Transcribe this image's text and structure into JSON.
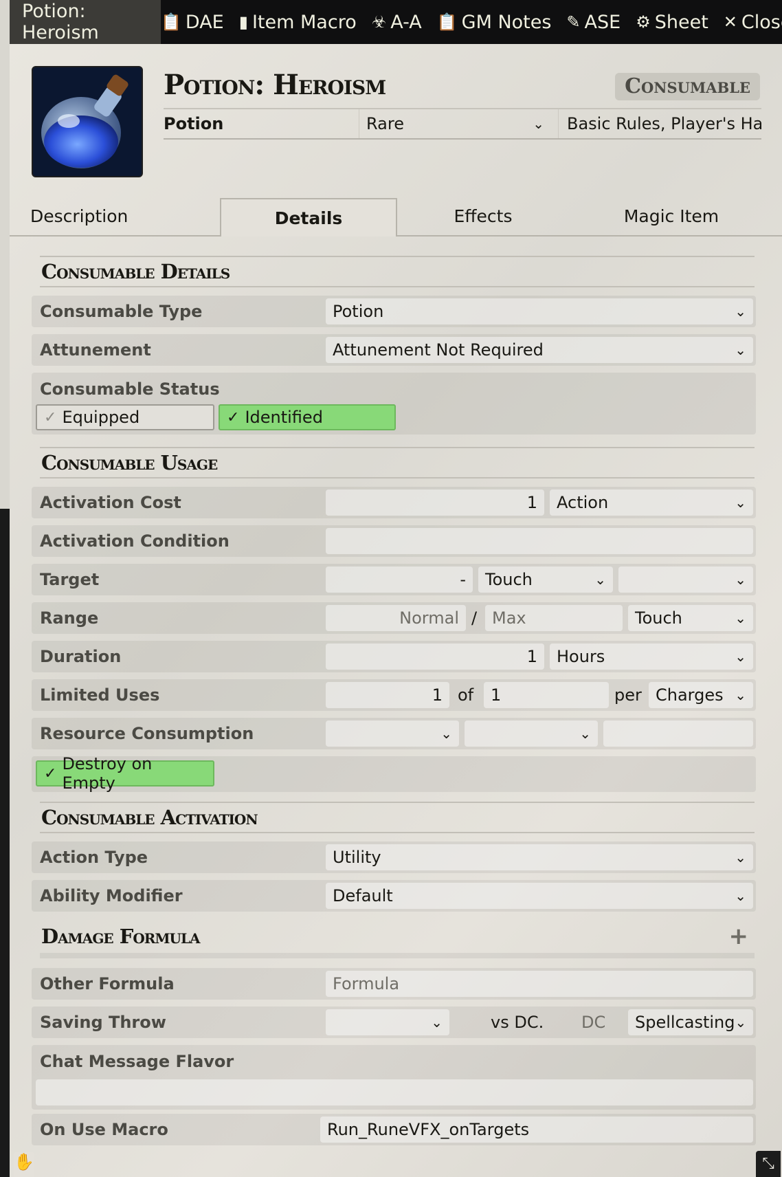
{
  "window": {
    "title": "Potion: Heroism",
    "controls": [
      {
        "label": "DAE",
        "icon": "clipboard-icon"
      },
      {
        "label": "Item Macro",
        "icon": "sd-card-icon"
      },
      {
        "label": "A-A",
        "icon": "biohazard-icon"
      },
      {
        "label": "GM Notes",
        "icon": "clipboard-icon"
      },
      {
        "label": "ASE",
        "icon": "magic-wand-icon"
      },
      {
        "label": "Sheet",
        "icon": "gear-icon"
      },
      {
        "label": "Close",
        "icon": "close-icon"
      }
    ]
  },
  "header": {
    "name": "Potion: Heroism",
    "type_badge": "Consumable",
    "subtype": "Potion",
    "rarity": "Rare",
    "source": "Basic Rules, Player's Ha"
  },
  "tabs": [
    "Description",
    "Details",
    "Effects",
    "Magic Item"
  ],
  "active_tab": "Details",
  "sections": {
    "details_title": "Consumable Details",
    "usage_title": "Consumable Usage",
    "activation_title": "Consumable Activation",
    "damage_title": "Damage Formula"
  },
  "details": {
    "consumable_type_label": "Consumable Type",
    "consumable_type": "Potion",
    "attunement_label": "Attunement",
    "attunement": "Attunement Not Required",
    "status_label": "Consumable Status",
    "equipped_label": "Equipped",
    "equipped": false,
    "identified_label": "Identified",
    "identified": true
  },
  "usage": {
    "activation_cost_label": "Activation Cost",
    "activation_cost_value": "1",
    "activation_cost_type": "Action",
    "activation_condition_label": "Activation Condition",
    "activation_condition_value": "",
    "target_label": "Target",
    "target_value": "-",
    "target_type": "Touch",
    "target_units": "",
    "range_label": "Range",
    "range_normal_placeholder": "Normal",
    "range_separator": "/",
    "range_max_placeholder": "Max",
    "range_units": "Touch",
    "duration_label": "Duration",
    "duration_value": "1",
    "duration_units": "Hours",
    "limited_uses_label": "Limited Uses",
    "uses_value": "1",
    "uses_of": "of",
    "uses_max": "1",
    "uses_per": "per",
    "uses_period": "Charges",
    "resource_label": "Resource Consumption",
    "destroy_label": "Destroy on Empty",
    "destroy_on_empty": true
  },
  "activation": {
    "action_type_label": "Action Type",
    "action_type": "Utility",
    "ability_modifier_label": "Ability Modifier",
    "ability_modifier": "Default"
  },
  "damage": {
    "add_icon": "plus-icon",
    "other_formula_label": "Other Formula",
    "other_formula_placeholder": "Formula",
    "saving_throw_label": "Saving Throw",
    "vs_dc": "vs DC.",
    "dc_placeholder": "DC",
    "dc_scaling": "Spellcasting",
    "chat_flavor_label": "Chat Message Flavor",
    "chat_flavor_value": "",
    "on_use_macro_label": "On Use Macro",
    "on_use_macro_value": "Run_RuneVFX_onTargets"
  }
}
